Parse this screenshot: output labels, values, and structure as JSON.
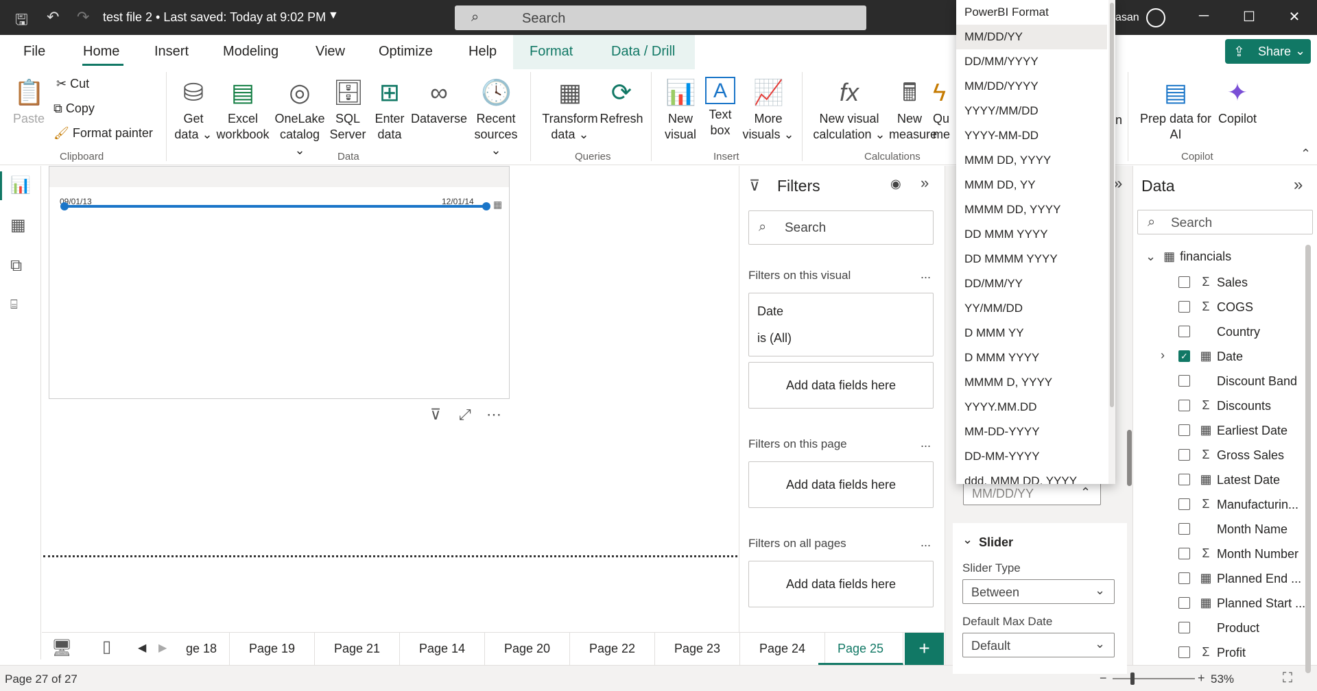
{
  "titlebar": {
    "doc_title": "test file 2 • Last saved: Today at 9:02 PM",
    "search_placeholder": "Search",
    "user_fragment": "asan"
  },
  "menu": {
    "tabs": [
      "File",
      "Home",
      "Insert",
      "Modeling",
      "View",
      "Optimize",
      "Help",
      "Format",
      "Data / Drill"
    ],
    "active_tab": "Home",
    "share_label": "Share"
  },
  "ribbon": {
    "clipboard": {
      "paste": "Paste",
      "cut": "Cut",
      "copy": "Copy",
      "format_painter": "Format painter",
      "group": "Clipboard"
    },
    "data": {
      "get_data": [
        "Get",
        "data"
      ],
      "excel": [
        "Excel",
        "workbook"
      ],
      "onelake": [
        "OneLake",
        "catalog"
      ],
      "sql": [
        "SQL",
        "Server"
      ],
      "enter": [
        "Enter",
        "data"
      ],
      "dataverse": [
        "Dataverse",
        ""
      ],
      "recent": [
        "Recent",
        "sources"
      ],
      "group": "Data"
    },
    "queries": {
      "transform": [
        "Transform",
        "data"
      ],
      "refresh": [
        "Refresh",
        ""
      ],
      "group": "Queries"
    },
    "insert": {
      "new_visual": [
        "New",
        "visual"
      ],
      "text_box": [
        "Text",
        "box"
      ],
      "more": [
        "More",
        "visuals"
      ],
      "group": "Insert"
    },
    "calculations": {
      "new_visual_calc": [
        "New visual",
        "calculation"
      ],
      "new_measure": [
        "New",
        "measure"
      ],
      "quick": [
        "Qu",
        "me"
      ],
      "group": "Calculations"
    },
    "hidden_fragment": "n",
    "copilot": {
      "prep": [
        "Prep data for",
        "AI"
      ],
      "copilot": [
        "Copilot",
        ""
      ],
      "group": "Copilot"
    }
  },
  "visual": {
    "start_date": "09/01/13",
    "end_date": "12/01/14"
  },
  "filters": {
    "title": "Filters",
    "search_placeholder": "Search",
    "on_visual": "Filters on this visual",
    "date_field": "Date",
    "date_condition": "is (All)",
    "add_fields": "Add data fields here",
    "on_page": "Filters on this page",
    "on_all": "Filters on all pages",
    "more": "..."
  },
  "format_pane": {
    "date_format_value": "MM/DD/YY",
    "slider_section": "Slider",
    "slider_type_label": "Slider Type",
    "slider_type_value": "Between",
    "default_max_label": "Default Max Date",
    "default_max_value": "Default"
  },
  "date_format_options": [
    "PowerBI Format",
    "MM/DD/YY",
    "DD/MM/YYYY",
    "MM/DD/YYYY",
    "YYYY/MM/DD",
    "YYYY-MM-DD",
    "MMM DD, YYYY",
    "MMM DD, YY",
    "MMMM DD, YYYY",
    "DD MMM YYYY",
    "DD MMMM YYYY",
    "DD/MM/YY",
    "YY/MM/DD",
    "D MMM YY",
    "D MMM YYYY",
    "MMMM D, YYYY",
    "YYYY.MM.DD",
    "MM-DD-YYYY",
    "DD-MM-YYYY",
    "ddd, MMM DD, YYYY"
  ],
  "date_format_selected": "MM/DD/YY",
  "data_pane": {
    "title": "Data",
    "search_placeholder": "Search",
    "table": "financials",
    "fields": [
      {
        "name": "Sales",
        "type": "Σ",
        "checked": false
      },
      {
        "name": "COGS",
        "type": "Σ",
        "checked": false
      },
      {
        "name": "Country",
        "type": "",
        "checked": false
      },
      {
        "name": "Date",
        "type": "▦",
        "checked": true,
        "expandable": true
      },
      {
        "name": "Discount Band",
        "type": "",
        "checked": false
      },
      {
        "name": "Discounts",
        "type": "Σ",
        "checked": false
      },
      {
        "name": "Earliest Date",
        "type": "▦",
        "checked": false
      },
      {
        "name": "Gross Sales",
        "type": "Σ",
        "checked": false
      },
      {
        "name": "Latest Date",
        "type": "▦",
        "checked": false
      },
      {
        "name": "Manufacturin...",
        "type": "Σ",
        "checked": false
      },
      {
        "name": "Month Name",
        "type": "",
        "checked": false
      },
      {
        "name": "Month Number",
        "type": "Σ",
        "checked": false
      },
      {
        "name": "Planned End ...",
        "type": "▦",
        "checked": false
      },
      {
        "name": "Planned Start ...",
        "type": "▦",
        "checked": false
      },
      {
        "name": "Product",
        "type": "",
        "checked": false
      },
      {
        "name": "Profit",
        "type": "Σ",
        "checked": false
      }
    ]
  },
  "pages": [
    "ge 18",
    "Page 19",
    "Page 21",
    "Page 14",
    "Page 20",
    "Page 22",
    "Page 23",
    "Page 24",
    "Page 25"
  ],
  "active_page": "Page 25",
  "status": {
    "page_info": "Page 27 of 27",
    "zoom": "53%"
  }
}
